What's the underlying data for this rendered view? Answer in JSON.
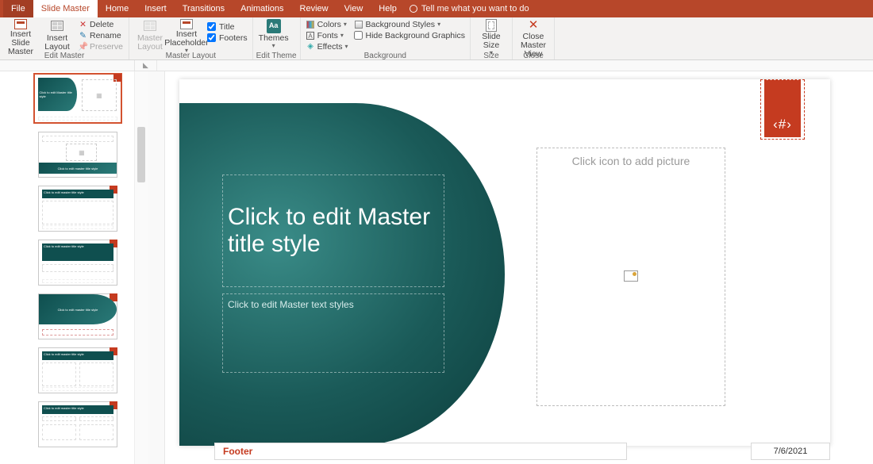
{
  "tabs": {
    "file": "File",
    "slide_master": "Slide Master",
    "home": "Home",
    "insert": "Insert",
    "transitions": "Transitions",
    "animations": "Animations",
    "review": "Review",
    "view": "View",
    "help": "Help",
    "tell_me": "Tell me what you want to do"
  },
  "ribbon": {
    "edit_master": {
      "insert_slide_master": "Insert Slide\nMaster",
      "insert_layout": "Insert\nLayout",
      "delete": "Delete",
      "rename": "Rename",
      "preserve": "Preserve",
      "group": "Edit Master"
    },
    "master_layout": {
      "master_layout": "Master\nLayout",
      "insert_placeholder": "Insert\nPlaceholder",
      "title": "Title",
      "footers": "Footers",
      "group": "Master Layout"
    },
    "edit_theme": {
      "themes": "Themes",
      "group": "Edit Theme"
    },
    "background": {
      "colors": "Colors",
      "fonts": "Fonts",
      "effects": "Effects",
      "bg_styles": "Background Styles",
      "hide_bg": "Hide Background Graphics",
      "group": "Background"
    },
    "size": {
      "slide_size": "Slide\nSize",
      "group": "Size"
    },
    "close": {
      "close_master": "Close\nMaster View",
      "group": "Close"
    }
  },
  "slide": {
    "title": "Click to edit Master title style",
    "text": "Click to edit Master text styles",
    "picture_hint": "Click icon to add picture",
    "page_num": "‹#›",
    "footer": "Footer",
    "date": "7/6/2021"
  },
  "thumbs": {
    "master_title": "Click to edit Master title style",
    "layout_title": "Click to edit master title style"
  }
}
